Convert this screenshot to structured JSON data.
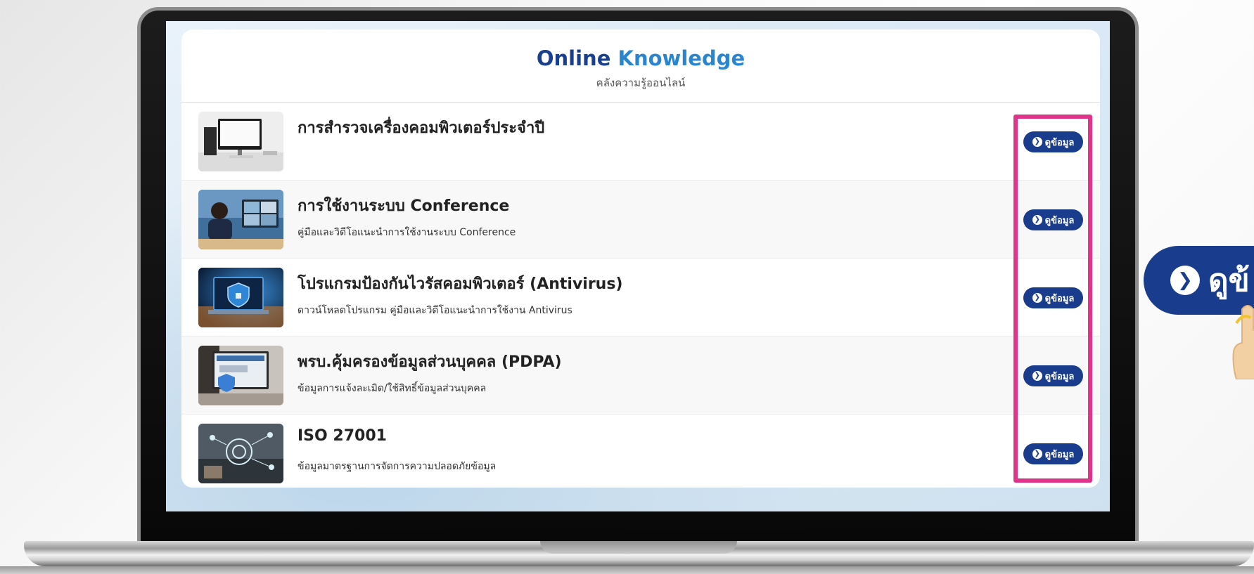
{
  "header": {
    "title_part1": "Online",
    "title_part2": "Knowledge",
    "subtitle": "คลังความรู้ออนไลน์"
  },
  "items": [
    {
      "title": "การสำรวจเครื่องคอมพิวเตอร์ประจำปี",
      "description": "",
      "button_label": "ดูข้อมูล",
      "icon": "computer-desk-thumbnail"
    },
    {
      "title": "การใช้งานระบบ Conference",
      "description": "คู่มือและวิดีโอแนะนำการใช้งานระบบ Conference",
      "button_label": "ดูข้อมูล",
      "icon": "video-conference-thumbnail"
    },
    {
      "title": "โปรแกรมป้องกันไวรัสคอมพิวเตอร์ (Antivirus)",
      "description": "ดาวน์โหลดโปรแกรม คู่มือและวิดีโอแนะนำการใช้งาน Antivirus",
      "button_label": "ดูข้อมูล",
      "icon": "shield-laptop-thumbnail"
    },
    {
      "title": "พรบ.คุ้มครองข้อมูลส่วนบุคคล (PDPA)",
      "description": "ข้อมูลการแจ้งละเมิด/ใช้สิทธิ์ข้อมูลส่วนบุคคล",
      "button_label": "ดูข้อมูล",
      "icon": "privacy-monitor-thumbnail"
    },
    {
      "title": "ISO 27001",
      "description": "ข้อมูลมาตรฐานการจัดการความปลอดภัยข้อมูล",
      "button_label": "ดูข้อมูล",
      "icon": "security-network-thumbnail"
    }
  ],
  "callout": {
    "label": "ดูข้",
    "icon": "chevron-right-circle-icon"
  },
  "colors": {
    "button": "#193c8c",
    "title_dark": "#193f8f",
    "title_light": "#2a85cf",
    "highlight": "#e0338a"
  }
}
